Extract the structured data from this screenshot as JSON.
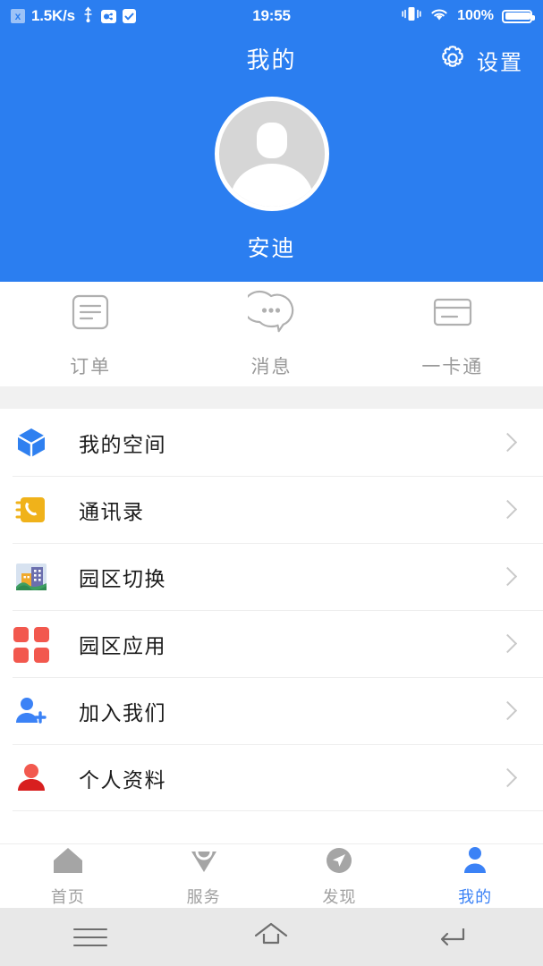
{
  "statusbar": {
    "netspeed": "1.5K/s",
    "x_badge": "x",
    "time": "19:55",
    "battery_percent": "100%",
    "icons": [
      "usb-icon",
      "usb-debug-icon",
      "checkbox-icon",
      "vibrate-icon",
      "wifi-icon",
      "battery-icon"
    ]
  },
  "header": {
    "title": "我的",
    "settings_label": "设置",
    "settings_icon": "gear-icon",
    "user_name": "安迪",
    "avatar_icon": "person-avatar",
    "bg_color": "#2b7ef0"
  },
  "quick_actions": [
    {
      "label": "订单",
      "icon": "order-document-icon"
    },
    {
      "label": "消息",
      "icon": "message-bubble-icon"
    },
    {
      "label": "一卡通",
      "icon": "card-icon"
    }
  ],
  "menu": [
    {
      "label": "我的空间",
      "icon": "cube-icon",
      "color": "#2f80f0"
    },
    {
      "label": "通讯录",
      "icon": "address-book-icon",
      "color": "#f0b21a"
    },
    {
      "label": "园区切换",
      "icon": "campus-switch-icon",
      "color": "#6b6fae"
    },
    {
      "label": "园区应用",
      "icon": "apps-grid-icon",
      "color": "#f2584e"
    },
    {
      "label": "加入我们",
      "icon": "add-person-icon",
      "color": "#3b82f6"
    },
    {
      "label": "个人资料",
      "icon": "person-profile-icon",
      "color": "#d81f1f"
    }
  ],
  "tabbar": [
    {
      "label": "首页",
      "icon": "home-icon",
      "active": false
    },
    {
      "label": "服务",
      "icon": "gem-icon",
      "active": false
    },
    {
      "label": "发现",
      "icon": "compass-icon",
      "active": false
    },
    {
      "label": "我的",
      "icon": "person-icon",
      "active": true
    }
  ],
  "system_nav": [
    {
      "icon": "menu-icon"
    },
    {
      "icon": "home-outline-icon"
    },
    {
      "icon": "back-icon"
    }
  ]
}
